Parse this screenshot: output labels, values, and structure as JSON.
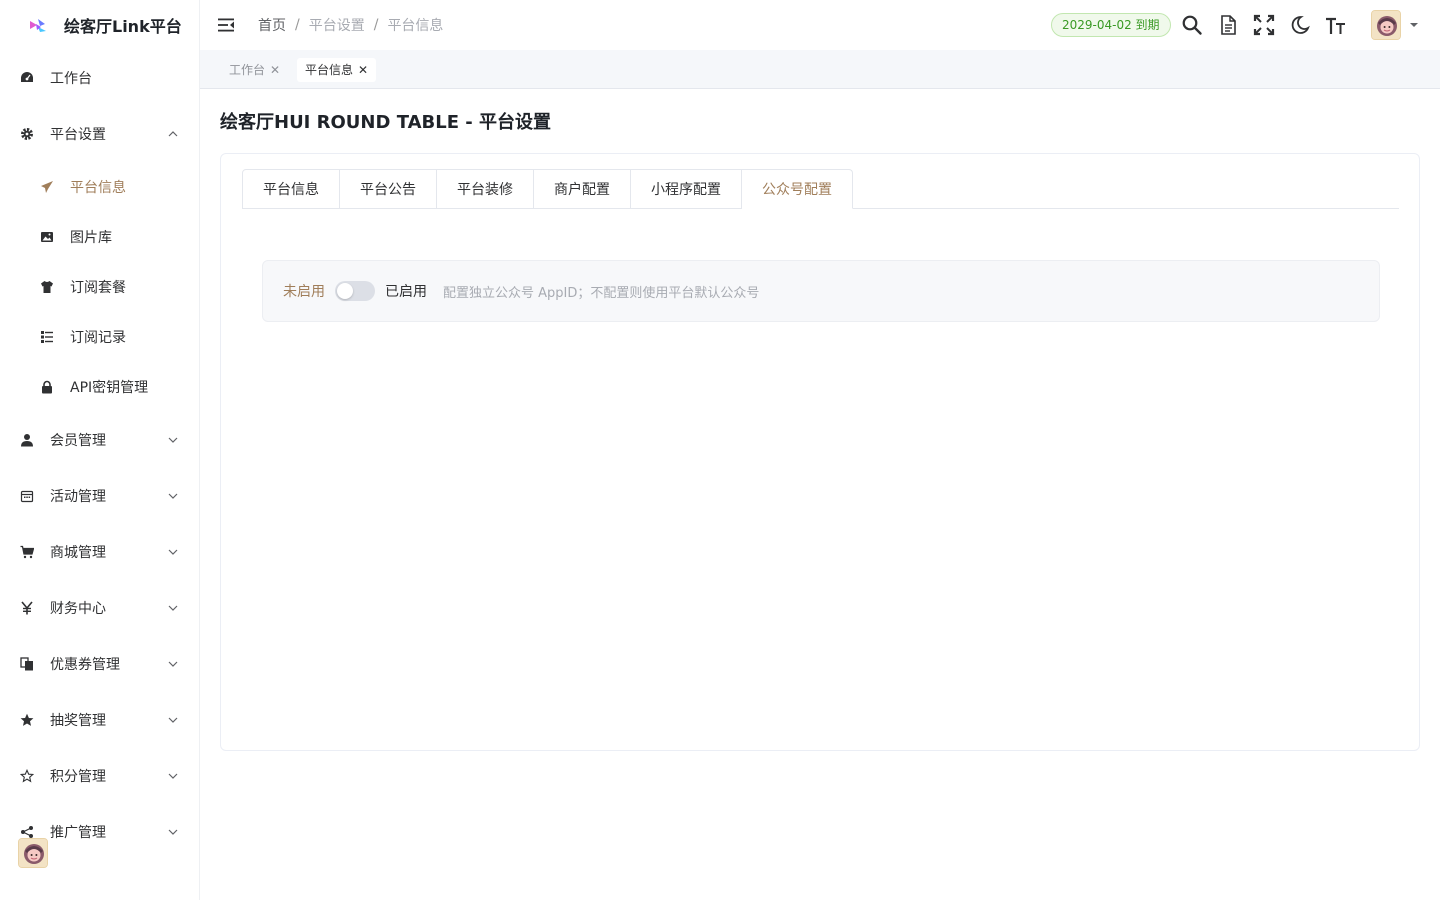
{
  "app": {
    "title": "绘客厅Link平台"
  },
  "sidebar": {
    "items": [
      {
        "label": "工作台",
        "icon": "dashboard-icon"
      },
      {
        "label": "平台设置",
        "icon": "gear-icon",
        "expanded": true
      },
      {
        "label": "会员管理",
        "icon": "user-icon"
      },
      {
        "label": "活动管理",
        "icon": "calendar-icon"
      },
      {
        "label": "商城管理",
        "icon": "cart-icon"
      },
      {
        "label": "财务中心",
        "icon": "yen-icon"
      },
      {
        "label": "优惠券管理",
        "icon": "coupon-icon"
      },
      {
        "label": "抽奖管理",
        "icon": "star-filled-icon"
      },
      {
        "label": "积分管理",
        "icon": "star-outline-icon"
      },
      {
        "label": "推广管理",
        "icon": "share-icon"
      }
    ],
    "subitems": [
      {
        "label": "平台信息",
        "icon": "paper-plane-icon",
        "active": true
      },
      {
        "label": "图片库",
        "icon": "image-icon"
      },
      {
        "label": "订阅套餐",
        "icon": "shirt-icon"
      },
      {
        "label": "订阅记录",
        "icon": "list-icon"
      },
      {
        "label": "API密钥管理",
        "icon": "lock-icon"
      }
    ]
  },
  "header": {
    "breadcrumb": [
      "首页",
      "平台设置",
      "平台信息"
    ],
    "expire": "2029-04-02 到期",
    "icons": [
      "search-icon",
      "document-icon",
      "fullscreen-icon",
      "moon-icon",
      "font-size-icon"
    ]
  },
  "tags": [
    {
      "label": "工作台",
      "active": false
    },
    {
      "label": "平台信息",
      "active": true
    }
  ],
  "page": {
    "title": "绘客厅HUI ROUND TABLE - 平台设置",
    "tabs": [
      "平台信息",
      "平台公告",
      "平台装修",
      "商户配置",
      "小程序配置",
      "公众号配置"
    ],
    "active_tab": 5,
    "config": {
      "off_label": "未启用",
      "on_label": "已启用",
      "enabled": false,
      "hint": "配置独立公众号 AppID；不配置则使用平台默认公众号"
    }
  },
  "colors": {
    "accent": "#a07e5a",
    "success": "#3a9a25"
  }
}
